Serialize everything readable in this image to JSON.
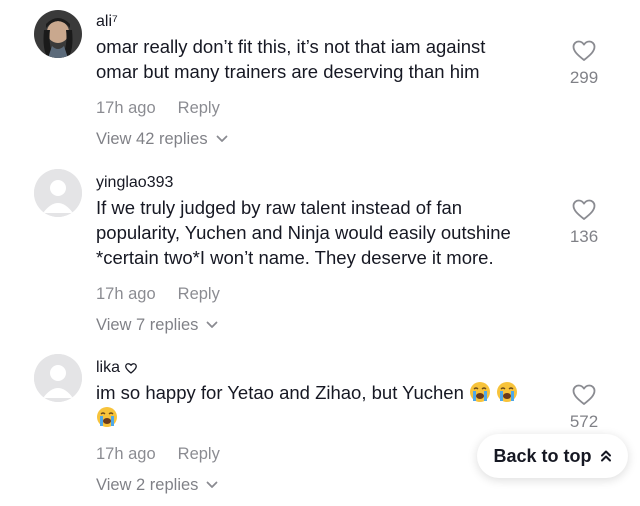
{
  "comments": [
    {
      "username": "ali⁷",
      "text_line1": "omar really don’t fit this, it’s not that iam against",
      "text_line2": "omar but many trainers are deserving than him",
      "time": "17h ago",
      "reply_label": "Reply",
      "view_replies": "View 42 replies",
      "likes": "299"
    },
    {
      "username": "yinglao393",
      "text_line1": "If we truly judged by raw talent instead of fan",
      "text_line2": "popularity, Yuchen and Ninja would easily outshine",
      "text_line3": "*certain two*I won’t name. They deserve it more.",
      "time": "17h ago",
      "reply_label": "Reply",
      "view_replies": "View 7 replies",
      "likes": "136"
    },
    {
      "username": "lika",
      "text_line1": "im so happy for Yetao and Zihao, but Yuchen",
      "time": "17h ago",
      "reply_label": "Reply",
      "view_replies": "View 2 replies",
      "likes": "572"
    }
  ],
  "back_to_top": "Back to top",
  "icons": {
    "like": "heart-outline-icon",
    "expand": "chevron-down-icon",
    "back_top": "double-chevron-up-icon",
    "username_badge": "heart-badge-icon",
    "emoji": "loudly-crying-face-emoji"
  },
  "colors": {
    "text": "#161823",
    "muted": "#8a8b91",
    "background": "#ffffff"
  }
}
